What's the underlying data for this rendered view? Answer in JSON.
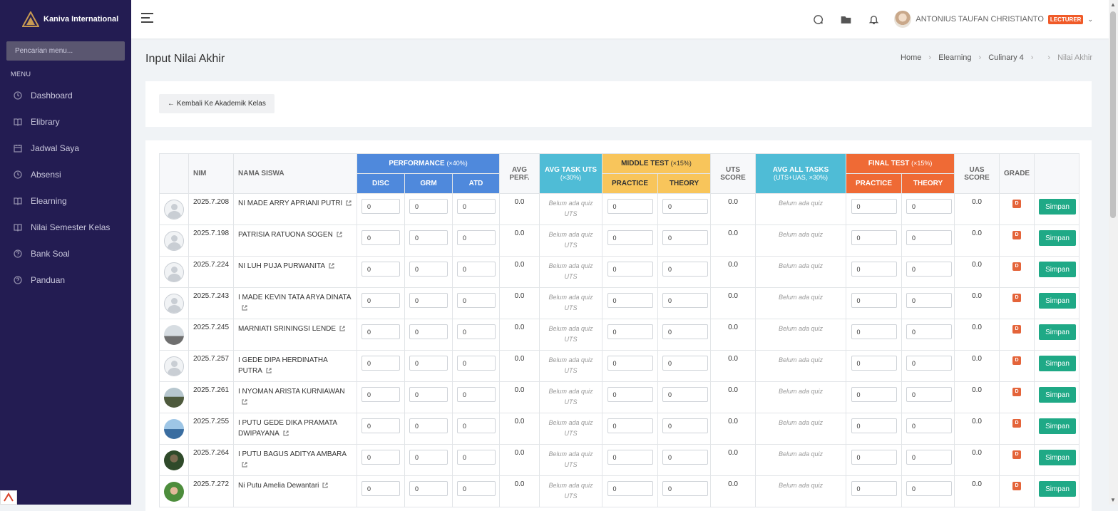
{
  "brand": {
    "name": "Kaniva International"
  },
  "sidebar": {
    "search_placeholder": "Pencarian menu...",
    "menu_label": "MENU",
    "items": [
      {
        "label": "Dashboard",
        "icon": "clock-icon"
      },
      {
        "label": "Elibrary",
        "icon": "book-icon"
      },
      {
        "label": "Jadwal Saya",
        "icon": "calendar-icon"
      },
      {
        "label": "Absensi",
        "icon": "clock-icon"
      },
      {
        "label": "Elearning",
        "icon": "book-icon"
      },
      {
        "label": "Nilai Semester Kelas",
        "icon": "book-icon"
      },
      {
        "label": "Bank Soal",
        "icon": "help-circle-icon"
      },
      {
        "label": "Panduan",
        "icon": "help-circle-icon"
      }
    ]
  },
  "topbar": {
    "user_name": "ANTONIUS TAUFAN CHRISTIANTO",
    "role_badge": "LECTURER"
  },
  "page": {
    "title": "Input Nilai Akhir",
    "breadcrumb": [
      "Home",
      "Elearning",
      "Culinary 4",
      "",
      "Nilai Akhir"
    ],
    "back_button": "← Kembali Ke Akademik Kelas"
  },
  "table": {
    "headers": {
      "nim": "NIM",
      "nama": "NAMA SISWA",
      "performance": "PERFORMANCE",
      "performance_weight": "(×40%)",
      "disc": "DISC",
      "grm": "GRM",
      "atd": "ATD",
      "avg_perf_1": "AVG",
      "avg_perf_2": "PERF.",
      "avg_task_uts": "AVG TASK UTS",
      "avg_task_uts_weight": "(×30%)",
      "middle_test": "MIDDLE TEST",
      "middle_test_weight": "(×15%)",
      "practice": "PRACTICE",
      "theory": "THEORY",
      "uts_score_1": "UTS",
      "uts_score_2": "SCORE",
      "avg_all_tasks": "AVG ALL TASKS",
      "avg_all_tasks_weight": "(UTS+UAS, ×30%)",
      "final_test": "FINAL TEST",
      "final_test_weight": "(×15%)",
      "uas_score_1": "UAS",
      "uas_score_2": "SCORE",
      "grade": "GRADE"
    },
    "rows": [
      {
        "nim": "2025.7.208",
        "nama": "NI MADE ARRY APRIANI PUTRI",
        "photo": "blank",
        "disc": "0",
        "grm": "0",
        "atd": "0",
        "avg_perf": "0.0",
        "avg_task_uts": "Belum ada quiz UTS",
        "mt_practice": "0",
        "mt_theory": "0",
        "uts_score": "0.0",
        "avg_all": "Belum ada quiz",
        "ft_practice": "0",
        "ft_theory": "0",
        "uas_score": "0.0",
        "grade": "D",
        "action": "Simpan"
      },
      {
        "nim": "2025.7.198",
        "nama": "PATRISIA RATUONA SOGEN",
        "photo": "blank",
        "disc": "0",
        "grm": "0",
        "atd": "0",
        "avg_perf": "0.0",
        "avg_task_uts": "Belum ada quiz UTS",
        "mt_practice": "0",
        "mt_theory": "0",
        "uts_score": "0.0",
        "avg_all": "Belum ada quiz",
        "ft_practice": "0",
        "ft_theory": "0",
        "uas_score": "0.0",
        "grade": "D",
        "action": "Simpan"
      },
      {
        "nim": "2025.7.224",
        "nama": "NI LUH PUJA PURWANITA",
        "photo": "blank",
        "disc": "0",
        "grm": "0",
        "atd": "0",
        "avg_perf": "0.0",
        "avg_task_uts": "Belum ada quiz UTS",
        "mt_practice": "0",
        "mt_theory": "0",
        "uts_score": "0.0",
        "avg_all": "Belum ada quiz",
        "ft_practice": "0",
        "ft_theory": "0",
        "uas_score": "0.0",
        "grade": "D",
        "action": "Simpan"
      },
      {
        "nim": "2025.7.243",
        "nama": "I MADE KEVIN TATA ARYA DINATA",
        "photo": "blank",
        "disc": "0",
        "grm": "0",
        "atd": "0",
        "avg_perf": "0.0",
        "avg_task_uts": "Belum ada quiz UTS",
        "mt_practice": "0",
        "mt_theory": "0",
        "uts_score": "0.0",
        "avg_all": "Belum ada quiz",
        "ft_practice": "0",
        "ft_theory": "0",
        "uas_score": "0.0",
        "grade": "D",
        "action": "Simpan"
      },
      {
        "nim": "2025.7.245",
        "nama": "MARNIATI SRININGSI LENDE",
        "photo": "p1",
        "disc": "0",
        "grm": "0",
        "atd": "0",
        "avg_perf": "0.0",
        "avg_task_uts": "Belum ada quiz UTS",
        "mt_practice": "0",
        "mt_theory": "0",
        "uts_score": "0.0",
        "avg_all": "Belum ada quiz",
        "ft_practice": "0",
        "ft_theory": "0",
        "uas_score": "0.0",
        "grade": "D",
        "action": "Simpan"
      },
      {
        "nim": "2025.7.257",
        "nama": "I GEDE DIPA HERDINATHA PUTRA",
        "photo": "blank",
        "disc": "0",
        "grm": "0",
        "atd": "0",
        "avg_perf": "0.0",
        "avg_task_uts": "Belum ada quiz UTS",
        "mt_practice": "0",
        "mt_theory": "0",
        "uts_score": "0.0",
        "avg_all": "Belum ada quiz",
        "ft_practice": "0",
        "ft_theory": "0",
        "uas_score": "0.0",
        "grade": "D",
        "action": "Simpan"
      },
      {
        "nim": "2025.7.261",
        "nama": "I NYOMAN ARISTA KURNIAWAN",
        "photo": "p2",
        "disc": "0",
        "grm": "0",
        "atd": "0",
        "avg_perf": "0.0",
        "avg_task_uts": "Belum ada quiz UTS",
        "mt_practice": "0",
        "mt_theory": "0",
        "uts_score": "0.0",
        "avg_all": "Belum ada quiz",
        "ft_practice": "0",
        "ft_theory": "0",
        "uas_score": "0.0",
        "grade": "D",
        "action": "Simpan"
      },
      {
        "nim": "2025.7.255",
        "nama": "I PUTU GEDE DIKA PRAMATA DWIPAYANA",
        "photo": "p3",
        "disc": "0",
        "grm": "0",
        "atd": "0",
        "avg_perf": "0.0",
        "avg_task_uts": "Belum ada quiz UTS",
        "mt_practice": "0",
        "mt_theory": "0",
        "uts_score": "0.0",
        "avg_all": "Belum ada quiz",
        "ft_practice": "0",
        "ft_theory": "0",
        "uas_score": "0.0",
        "grade": "D",
        "action": "Simpan"
      },
      {
        "nim": "2025.7.264",
        "nama": "I PUTU BAGUS ADITYA AMBARA",
        "photo": "p4",
        "disc": "0",
        "grm": "0",
        "atd": "0",
        "avg_perf": "0.0",
        "avg_task_uts": "Belum ada quiz UTS",
        "mt_practice": "0",
        "mt_theory": "0",
        "uts_score": "0.0",
        "avg_all": "Belum ada quiz",
        "ft_practice": "0",
        "ft_theory": "0",
        "uas_score": "0.0",
        "grade": "D",
        "action": "Simpan"
      },
      {
        "nim": "2025.7.272",
        "nama": "Ni Putu Amelia Dewantari",
        "photo": "p5",
        "disc": "0",
        "grm": "0",
        "atd": "0",
        "avg_perf": "0.0",
        "avg_task_uts": "Belum ada quiz UTS",
        "mt_practice": "0",
        "mt_theory": "0",
        "uts_score": "0.0",
        "avg_all": "Belum ada quiz",
        "ft_practice": "0",
        "ft_theory": "0",
        "uas_score": "0.0",
        "grade": "D",
        "action": "Simpan"
      }
    ]
  },
  "colors": {
    "sidebar_bg": "#231c52",
    "performance": "#4f89dc",
    "avg_task": "#4fbcd6",
    "middle_test": "#f8c55b",
    "final_test": "#ef6a35",
    "save_button": "#1fa986",
    "grade_badge": "#e4643a"
  }
}
